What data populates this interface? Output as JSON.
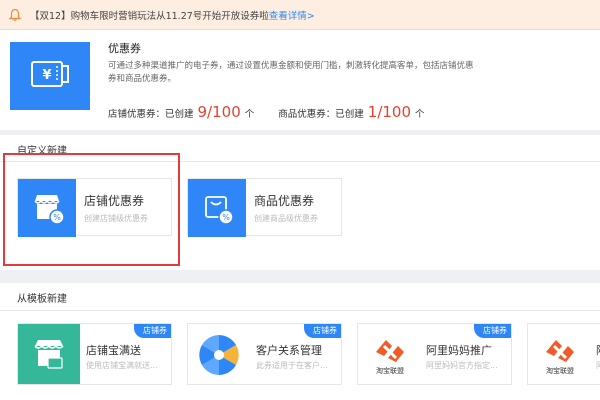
{
  "notice": {
    "text": "【双12】购物车限时营销玩法从11.27号开始开放设券啦",
    "link": "查看详情>"
  },
  "overview": {
    "title": "优惠券",
    "description": "可通过多种渠道推广的电子券，通过设置优惠金额和使用门槛，刺激转化提高客单，包括店铺优惠券和商品优惠券。",
    "store_label": "店铺优惠券：已创建",
    "store_count": "9/100",
    "store_unit": "个",
    "product_label": "商品优惠券：已创建",
    "product_count": "1/100",
    "product_unit": "个"
  },
  "custom": {
    "title": "自定义新建",
    "cards": [
      {
        "title": "店铺优惠券",
        "subtitle": "创建店铺级优惠券"
      },
      {
        "title": "商品优惠券",
        "subtitle": "创建商品级优惠券"
      }
    ]
  },
  "templates": {
    "title": "从模板新建",
    "cards": [
      {
        "title": "店铺宝满送",
        "subtitle": "使用店铺宝满就送...",
        "badge": "店铺券"
      },
      {
        "title": "客户关系管理",
        "subtitle": "此券适用于在客户...",
        "badge": "店铺券"
      },
      {
        "title": "阿里妈妈推广",
        "subtitle": "阿里妈妈官方指定...",
        "badge": "店铺券",
        "logo_text": "淘宝联盟"
      },
      {
        "title": "阿",
        "subtitle": "阿",
        "badge": "",
        "logo_text": "淘宝联盟"
      }
    ]
  },
  "colors": {
    "accent": "#2f86f6",
    "highlight": "#e53a3a",
    "count": "#e8402e"
  }
}
